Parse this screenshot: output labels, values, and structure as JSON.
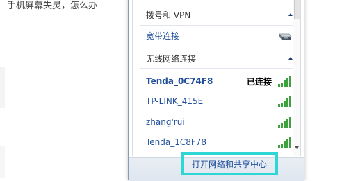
{
  "background": {
    "partial_text": "手机屏幕失灵，怎么办"
  },
  "flyout": {
    "sections": [
      {
        "header": "拨号和 VPN",
        "items": [
          {
            "name": "宽带连接",
            "icon": "ethernet-icon",
            "status": ""
          }
        ]
      },
      {
        "header": "无线网络连接",
        "items": [
          {
            "name": "Tenda_0C74F8",
            "icon": "wifi-signal-icon",
            "status": "已连接",
            "bold": true
          },
          {
            "name": "TP-LINK_415E",
            "icon": "wifi-signal-icon",
            "status": ""
          },
          {
            "name": "zhang'rui",
            "icon": "wifi-signal-icon",
            "status": ""
          },
          {
            "name": "Tenda_1C8F78",
            "icon": "wifi-signal-icon",
            "status": ""
          }
        ]
      }
    ],
    "footer_link": "打开网络和共享中心"
  },
  "colors": {
    "link": "#1f4e9a",
    "highlight_box": "#2ed6d6",
    "signal_green": "#3ca33c"
  }
}
